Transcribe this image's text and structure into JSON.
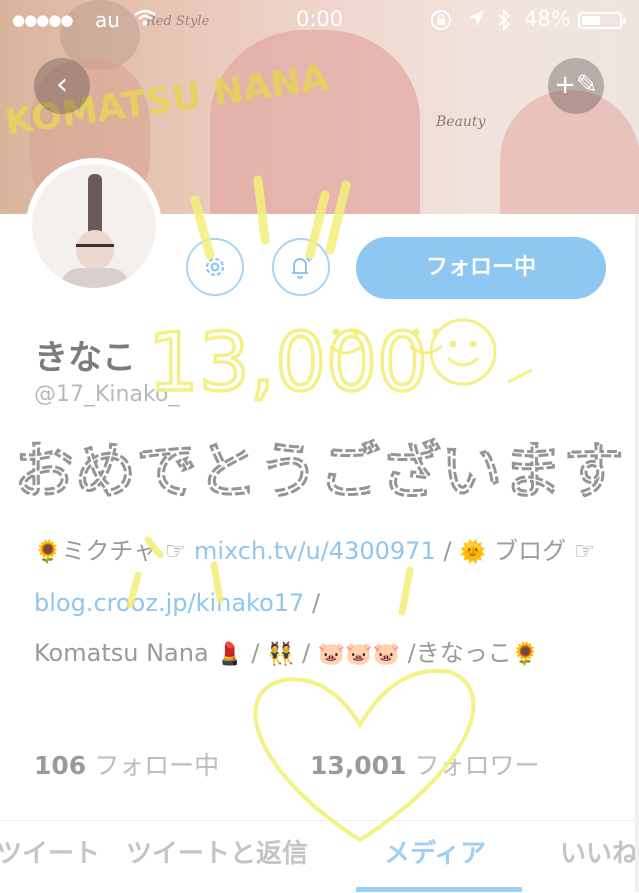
{
  "status_bar": {
    "signal": "●●●●●",
    "carrier": "au",
    "time": "0:00",
    "battery_percent": "48%",
    "battery_level": 0.48
  },
  "banner": {
    "text_red_style": "Red Style",
    "text_beauty": "Beauty",
    "name_art": "KOMATSU NANA",
    "back_icon": "‹",
    "compose_icon": "+✎"
  },
  "profile": {
    "display_name": "きなこ",
    "handle": "@17_Kinako_",
    "follow_button_label": "フォロー中"
  },
  "bio": {
    "emoji_sunflower": "🌻",
    "mixch_label": "ミクチャ",
    "pointer": "☞",
    "mixch_link": "mixch.tv/u/4300971",
    "sep1": " / ",
    "emoji_sun": "🌞",
    "blog_label": "ブログ",
    "blog_link": "blog.crooz.jp/kinako17",
    "sep2": " /",
    "name_en": "Komatsu Nana",
    "emoji_lipstick": "💄",
    "emoji_dancers": "👯",
    "emoji_pigs": "🐷🐷🐷",
    "tail": "/きなっこ",
    "emoji_sunflower_end": "🌻"
  },
  "stats": {
    "following_count": "106",
    "following_label": "フォロー中",
    "followers_count": "13,001",
    "followers_label": "フォロワー"
  },
  "tabs": [
    {
      "label": "ツイート"
    },
    {
      "label": "ツイートと返信"
    },
    {
      "label": "メディア"
    },
    {
      "label": "いいね"
    }
  ],
  "doodle": {
    "count_text": "13,000",
    "congrats_text": "おめでとうございます",
    "color_yellow": "#f3ef7a",
    "color_gray": "#8a8a8a"
  }
}
